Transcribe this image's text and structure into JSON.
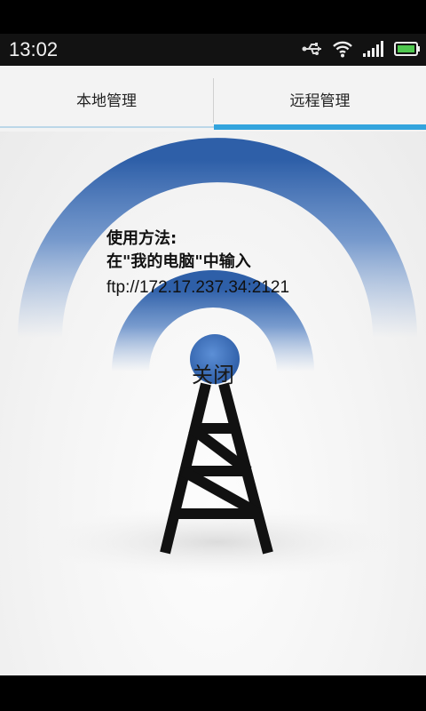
{
  "status_bar": {
    "time": "13:02",
    "icons": [
      "usb-icon",
      "wifi-icon",
      "signal-icon",
      "battery-icon"
    ]
  },
  "tabs": [
    {
      "label": "本地管理",
      "active": false
    },
    {
      "label": "远程管理",
      "active": true
    }
  ],
  "main": {
    "instruction_title": "使用方法:",
    "instruction_line": "在\"我的电脑\"中输入",
    "ftp_address": "ftp://172.17.237.34:2121",
    "close_label": "关闭"
  },
  "colors": {
    "accent": "#33a4dd",
    "arc_blue": "#3d6fb3",
    "tower": "#111111"
  }
}
